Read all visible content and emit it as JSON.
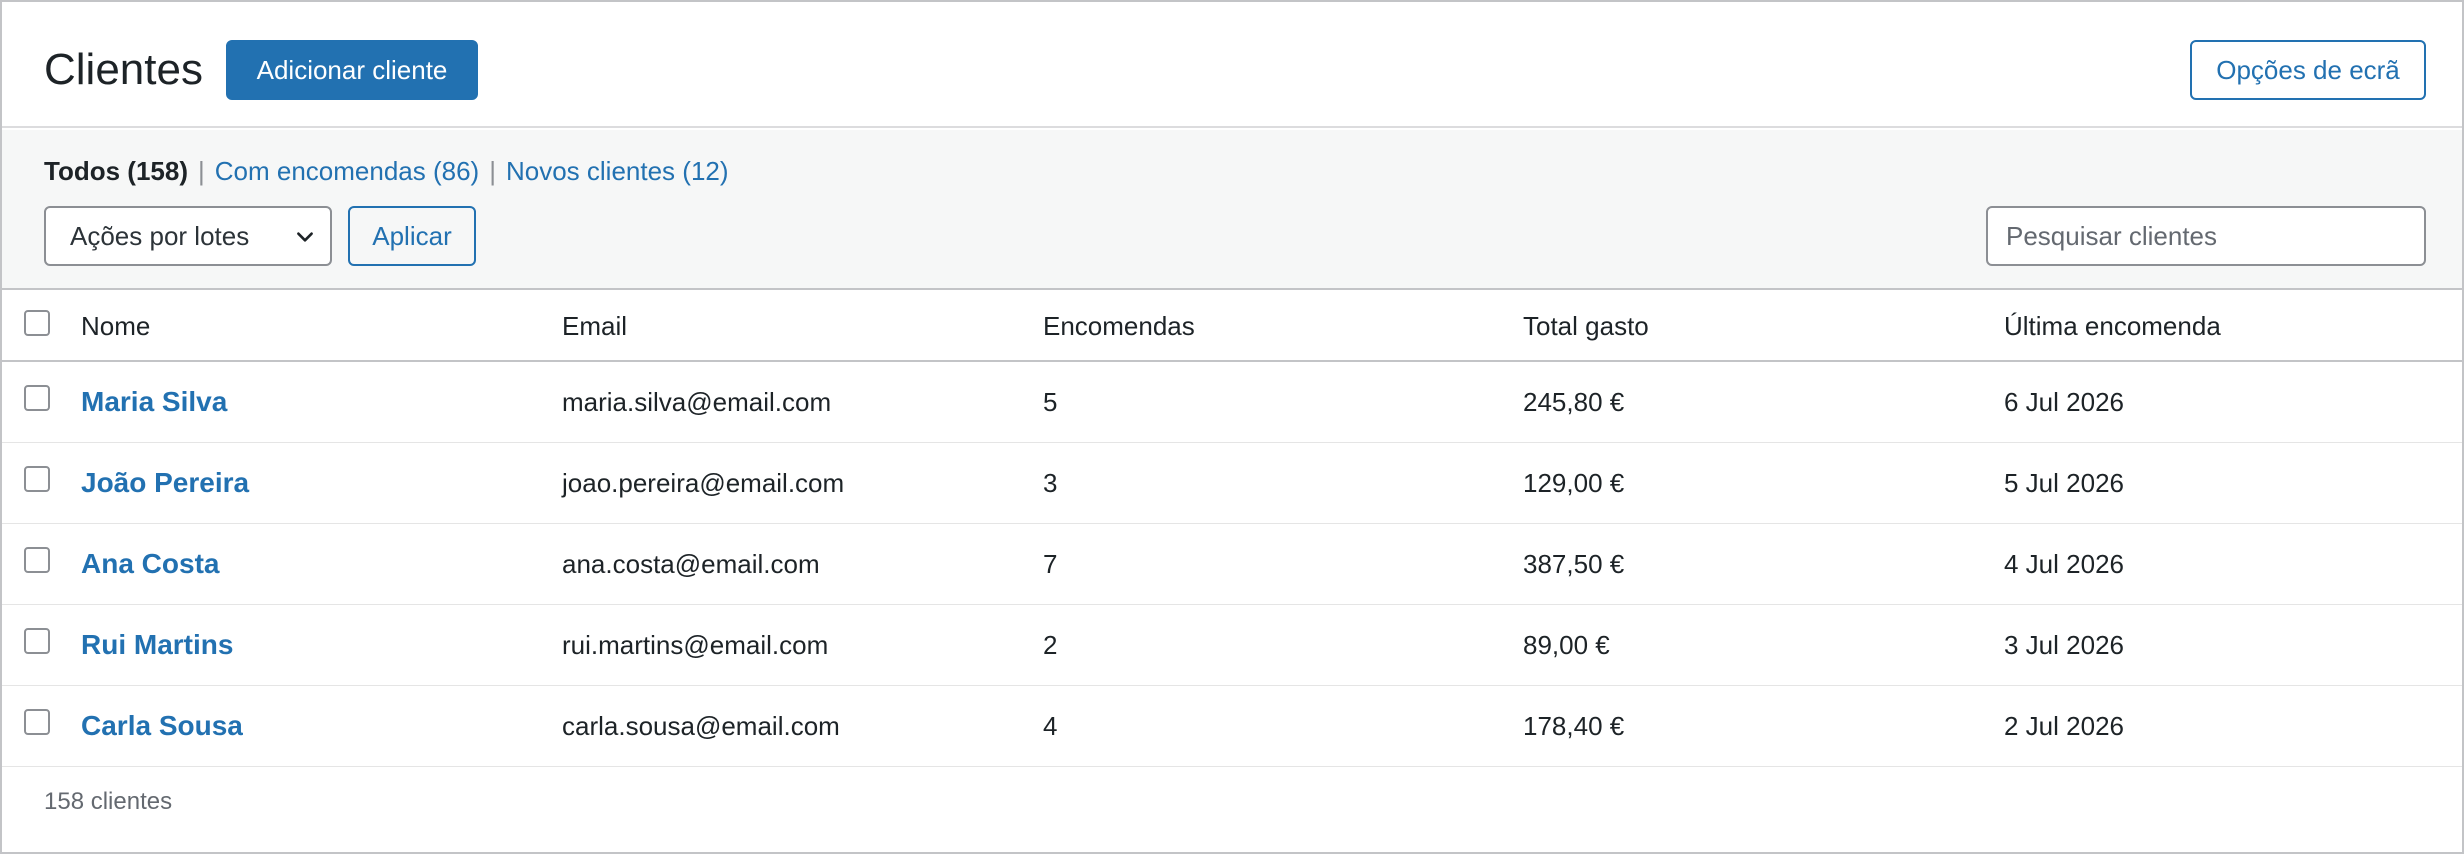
{
  "header": {
    "title": "Clientes",
    "add_button": "Adicionar cliente",
    "screen_options": "Opções de ecrã"
  },
  "views": {
    "all": "Todos (158)",
    "with_orders": "Com encomendas (86)",
    "new_customers": "Novos clientes (12)",
    "separator": "|"
  },
  "bulk": {
    "selected": "Ações por lotes",
    "apply": "Aplicar"
  },
  "search": {
    "placeholder": "Pesquisar clientes",
    "value": ""
  },
  "table": {
    "columns": [
      "Nome",
      "Email",
      "Encomendas",
      "Total gasto",
      "Última encomenda"
    ],
    "rows": [
      {
        "name": "Maria Silva",
        "email": "maria.silva@email.com",
        "orders": "5",
        "total": "245,80 €",
        "last": "6 Jul 2026"
      },
      {
        "name": "João Pereira",
        "email": "joao.pereira@email.com",
        "orders": "3",
        "total": "129,00 €",
        "last": "5 Jul 2026"
      },
      {
        "name": "Ana Costa",
        "email": "ana.costa@email.com",
        "orders": "7",
        "total": "387,50 €",
        "last": "4 Jul 2026"
      },
      {
        "name": "Rui Martins",
        "email": "rui.martins@email.com",
        "orders": "2",
        "total": "89,00 €",
        "last": "3 Jul 2026"
      },
      {
        "name": "Carla Sousa",
        "email": "carla.sousa@email.com",
        "orders": "4",
        "total": "178,40 €",
        "last": "2 Jul 2026"
      }
    ]
  },
  "footer": {
    "count": "158 clientes"
  },
  "colors": {
    "accent": "#2271b1",
    "text": "#1d2327",
    "muted": "#646970",
    "border": "#c3c4c7",
    "filter_bg": "#f6f7f7"
  }
}
